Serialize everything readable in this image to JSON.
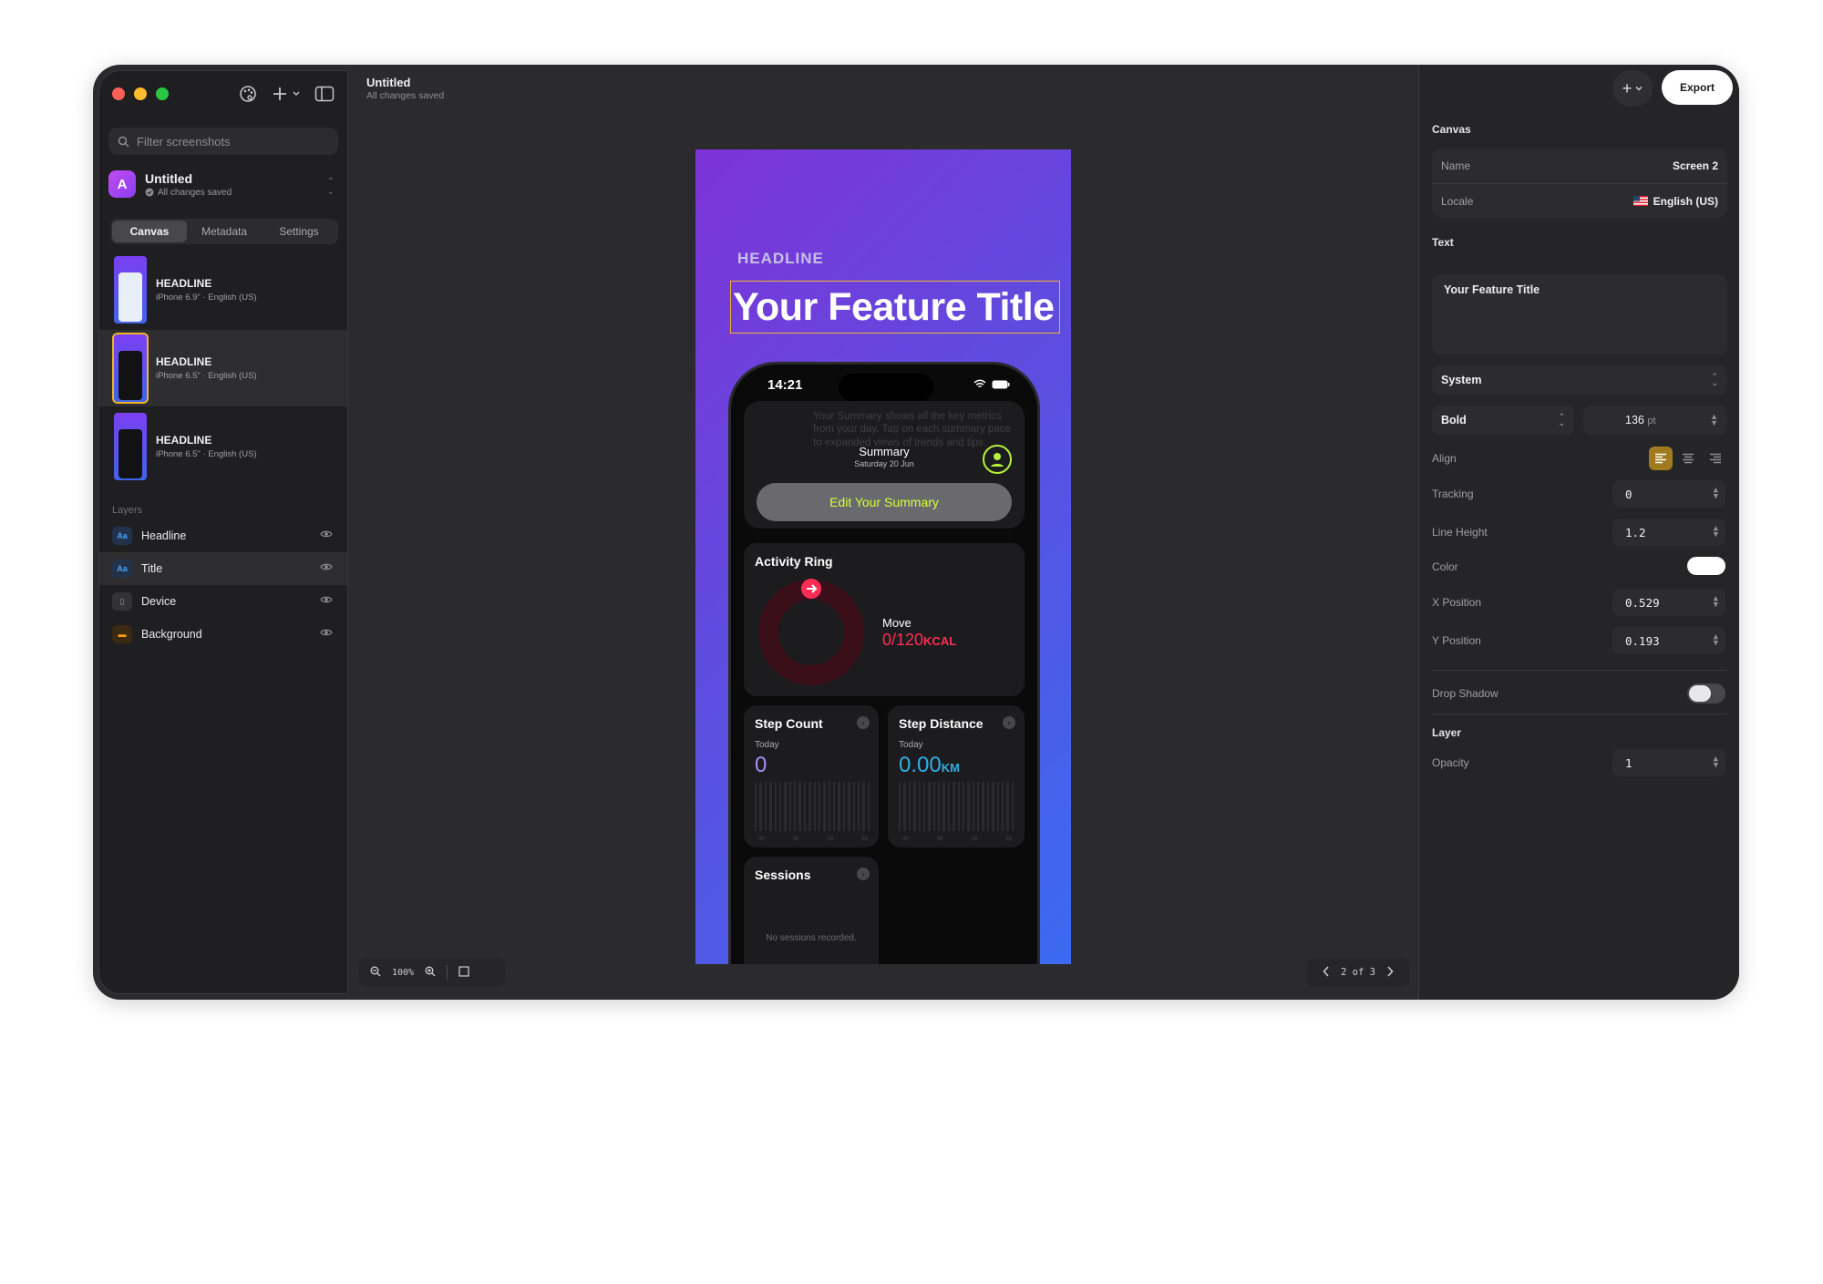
{
  "app": {
    "doc_title": "Untitled",
    "doc_status": "All changes saved"
  },
  "sidebar": {
    "filter_placeholder": "Filter screenshots",
    "project": {
      "avatar_letter": "A",
      "name": "Untitled",
      "status": "All changes saved"
    },
    "tabs": [
      {
        "label": "Canvas",
        "active": true
      },
      {
        "label": "Metadata",
        "active": false
      },
      {
        "label": "Settings",
        "active": false
      }
    ],
    "screenshots": [
      {
        "title": "HEADLINE",
        "subtitle": "iPhone 6.9\" · English (US)",
        "selected": false
      },
      {
        "title": "HEADLINE",
        "subtitle": "iPhone 6.5\" · English (US)",
        "selected": true
      },
      {
        "title": "HEADLINE",
        "subtitle": "iPhone 6.5\" · English (US)",
        "selected": false
      }
    ],
    "layers_label": "Layers",
    "layers": [
      {
        "name": "Headline",
        "icon": "text-layer-icon",
        "selected": false
      },
      {
        "name": "Title",
        "icon": "text-layer-icon",
        "selected": true
      },
      {
        "name": "Device",
        "icon": "device-icon",
        "selected": false
      },
      {
        "name": "Background",
        "icon": "background-icon",
        "selected": false
      }
    ]
  },
  "canvas": {
    "zoom": "100%",
    "pager": "2 of 3",
    "preview": {
      "headline": "HEADLINE",
      "title": "Your Feature Title",
      "phone": {
        "time": "14:21",
        "summary_ghost_text": "Your Summary shows all the key metrics from your day. Tap on each summary pace to expanded views of trends and tips.",
        "summary_title": "Summary",
        "summary_date": "Saturday 20 Jun",
        "edit_button": "Edit Your Summary",
        "activity": {
          "title": "Activity Ring",
          "move_label": "Move",
          "move_value": "0/120",
          "move_unit": "KCAL"
        },
        "step_count": {
          "title": "Step Count",
          "period": "Today",
          "value": "0"
        },
        "step_distance": {
          "title": "Step Distance",
          "period": "Today",
          "value": "0.00",
          "unit": "KM"
        },
        "sessions": {
          "title": "Sessions",
          "empty": "No sessions recorded."
        },
        "axis_ticks": [
          "00",
          "06",
          "12",
          "18"
        ]
      }
    }
  },
  "inspector": {
    "export_label": "Export",
    "canvas_section": "Canvas",
    "name_label": "Name",
    "name_value": "Screen 2",
    "locale_label": "Locale",
    "locale_value": "English (US)",
    "text_section": "Text",
    "text_value": "Your Feature Title",
    "font_family": "System",
    "font_weight": "Bold",
    "font_size": "136",
    "font_size_unit": "pt",
    "align_label": "Align",
    "align_selected": "left",
    "tracking_label": "Tracking",
    "tracking_value": "0",
    "line_height_label": "Line Height",
    "line_height_value": "1.2",
    "color_label": "Color",
    "color_value": "#ffffff",
    "x_label": "X Position",
    "x_value": "0.529",
    "y_label": "Y Position",
    "y_value": "0.193",
    "shadow_label": "Drop Shadow",
    "shadow_on": false,
    "layer_section": "Layer",
    "opacity_label": "Opacity",
    "opacity_value": "1"
  },
  "colors": {
    "accent": "#f0b429",
    "move_red": "#ff2d55",
    "step_purple": "#a78bfa",
    "distance_cyan": "#32ade6",
    "lime": "#d6ff3a"
  }
}
